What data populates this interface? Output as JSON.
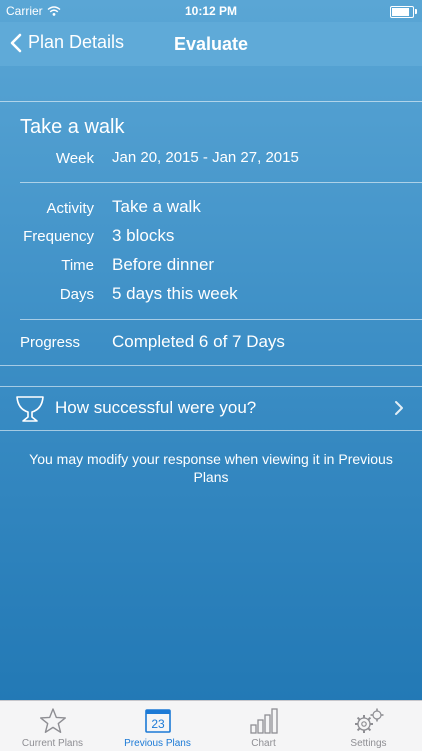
{
  "status_bar": {
    "carrier": "Carrier",
    "time": "10:12 PM",
    "battery_level": 0.95
  },
  "nav": {
    "back_label": "Plan Details",
    "title": "Evaluate"
  },
  "plan": {
    "title": "Take a walk",
    "week_label": "Week",
    "week_value": "Jan 20, 2015 - Jan 27, 2015",
    "details": [
      {
        "label": "Activity",
        "value": "Take a walk"
      },
      {
        "label": "Frequency",
        "value": "3 blocks"
      },
      {
        "label": "Time",
        "value": "Before dinner"
      },
      {
        "label": "Days",
        "value": "5 days this week"
      }
    ],
    "progress_label": "Progress",
    "progress_value": "Completed 6 of 7 Days"
  },
  "evaluate": {
    "label": "How successful were you?",
    "icon": "trophy-icon"
  },
  "note": "You may modify your response when viewing it in Previous Plans",
  "tabs": [
    {
      "label": "Current Plans",
      "icon": "star-icon",
      "active": false
    },
    {
      "label": "Previous Plans",
      "icon": "calendar-icon",
      "badge": "23",
      "active": true
    },
    {
      "label": "Chart",
      "icon": "bar-chart-icon",
      "active": false
    },
    {
      "label": "Settings",
      "icon": "gears-icon",
      "active": false
    }
  ],
  "colors": {
    "accent": "#1c7ad6",
    "nav_bg": "#5faad8"
  }
}
